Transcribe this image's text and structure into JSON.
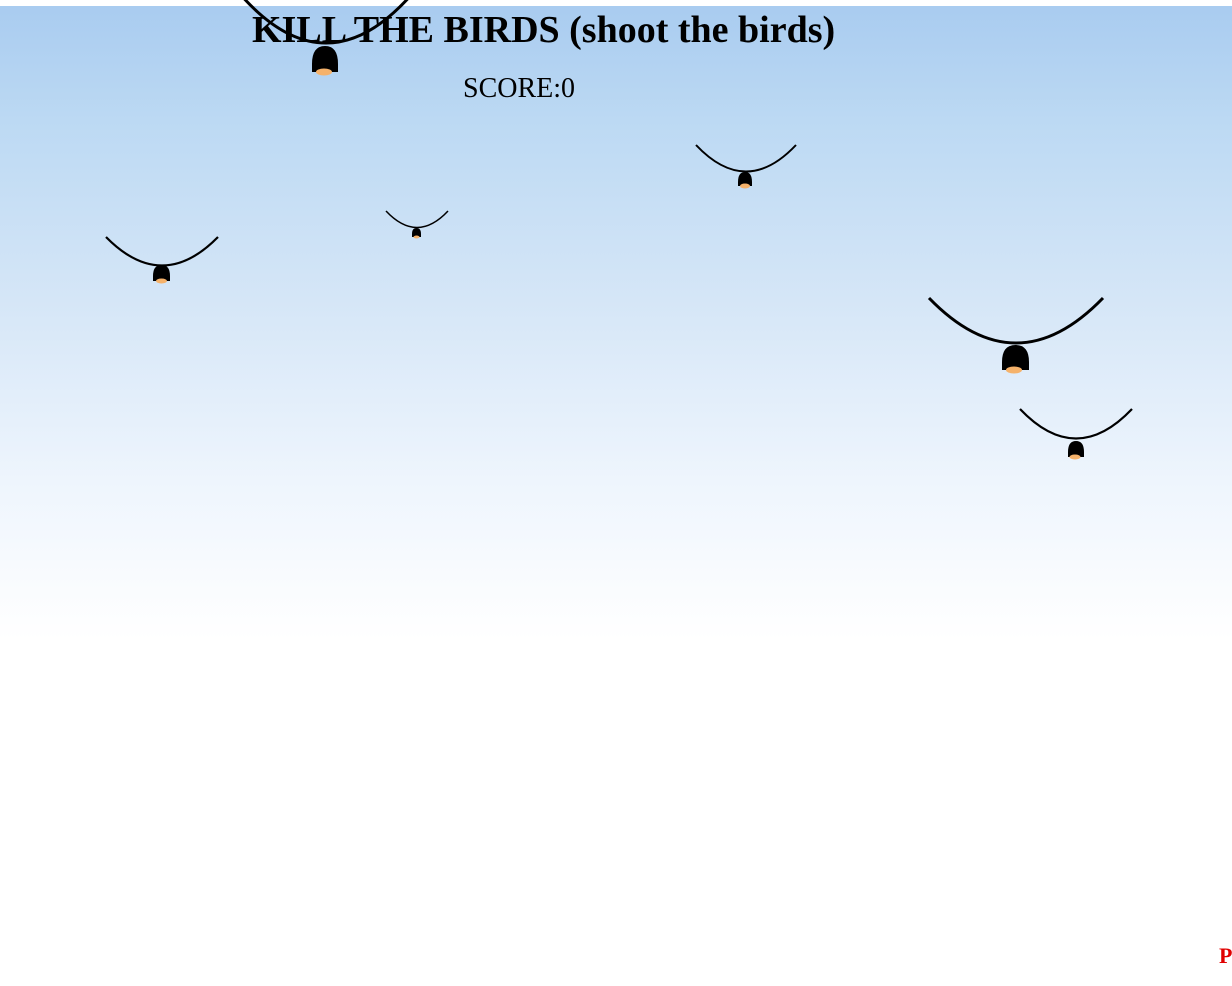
{
  "game": {
    "title": "KILL THE BIRDS (shoot the birds)",
    "score_text": "SCORE:0",
    "corner_label": "P",
    "colors": {
      "sky_top": "#a8cbf0",
      "sky_bottom": "#ffffff",
      "bird_body": "#000000",
      "bird_beak": "#f5b26b",
      "corner_label": "#e00000"
    },
    "birds_count": 6,
    "bird_icon": "bird-icon"
  }
}
